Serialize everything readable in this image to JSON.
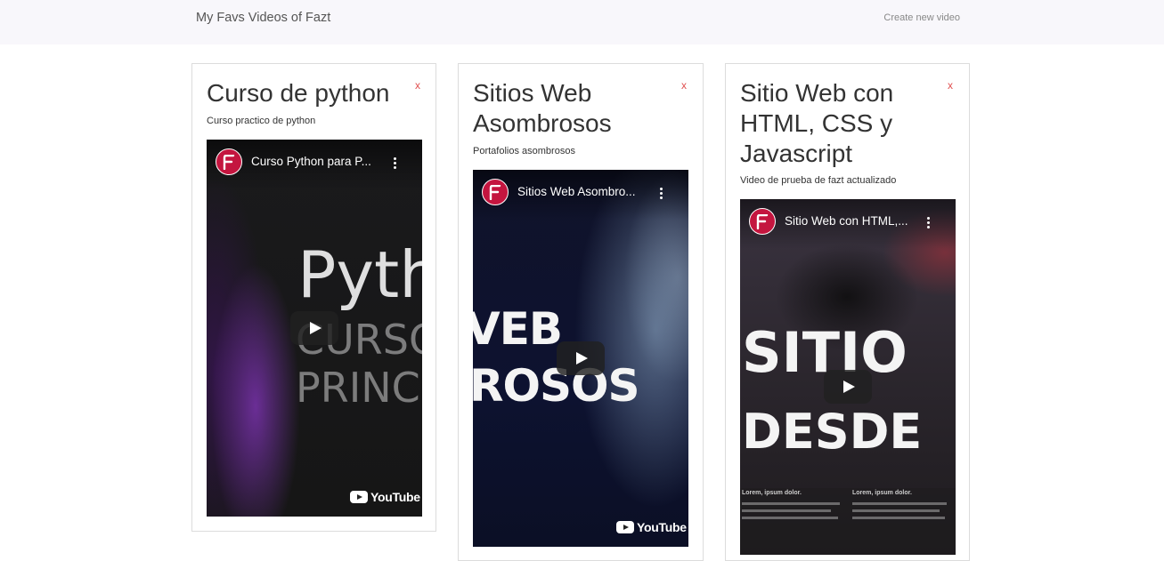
{
  "navbar": {
    "brand": "My Favs Videos of Fazt",
    "create_link": "Create new video"
  },
  "videos": [
    {
      "title": "Curso de python",
      "description": "Curso practico de python",
      "close_label": "x",
      "embed": {
        "title": "Curso Python para P...",
        "thumb_lines": [
          "Pyth",
          "CURSO",
          "PRINC"
        ],
        "youtube_label": "YouTube"
      }
    },
    {
      "title": "Sitios Web Asombrosos",
      "description": "Portafolios asombrosos",
      "close_label": "x",
      "embed": {
        "title": "Sitios Web Asombro...",
        "thumb_lines": [
          "VEB",
          "ROSOS"
        ],
        "youtube_label": "YouTube"
      }
    },
    {
      "title": "Sitio Web con HTML, CSS y Javascript",
      "description": "Video de prueba de fazt actualizado",
      "close_label": "x",
      "embed": {
        "title": "Sitio Web con HTML,...",
        "thumb_lines": [
          "SITIO",
          "DESDE"
        ],
        "mock_labels": [
          "Lorem, ipsum dolor.",
          "Lorem, ipsum dolor."
        ]
      }
    }
  ],
  "colors": {
    "navbar_bg": "#f8f7fb",
    "close": "#e05050",
    "channel_avatar": "#c4153f"
  },
  "icons": {
    "channel": "fazt-logo-icon",
    "menu": "more-vertical-icon",
    "play": "play-icon",
    "youtube": "youtube-icon",
    "close": "close-icon"
  }
}
